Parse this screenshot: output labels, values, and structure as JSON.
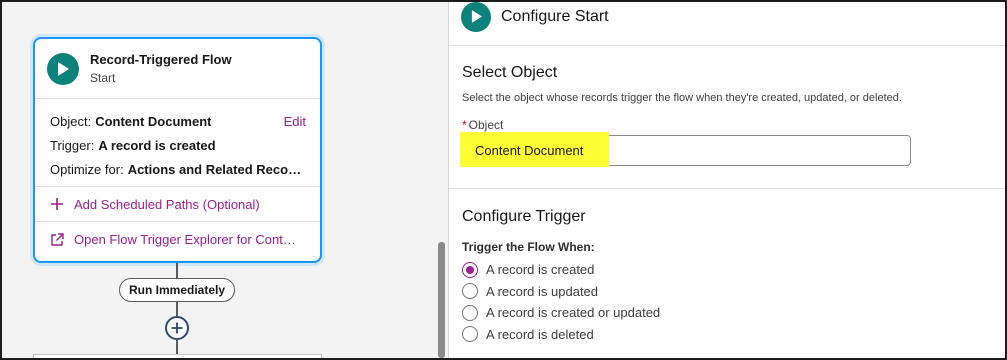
{
  "flow_node": {
    "title": "Record-Triggered Flow",
    "subtitle": "Start",
    "object_label": "Object:",
    "object_value": "Content Document",
    "edit_label": "Edit",
    "trigger_label": "Trigger:",
    "trigger_value": "A record is created",
    "optimize_label": "Optimize for:",
    "optimize_value": "Actions and Related Records",
    "add_paths_label": "Add Scheduled Paths (Optional)",
    "explorer_label": "Open Flow Trigger Explorer for Content Document"
  },
  "path": {
    "run_immediately_label": "Run Immediately"
  },
  "panel": {
    "title": "Configure Start",
    "select_object": {
      "heading": "Select Object",
      "help": "Select the object whose records trigger the flow when they're created, updated, or deleted.",
      "required_mark": "*",
      "field_label": "Object",
      "field_value": "Content Document"
    },
    "configure_trigger": {
      "heading": "Configure Trigger",
      "sub_label": "Trigger the Flow When:",
      "options": [
        {
          "label": "A record is created",
          "selected": true
        },
        {
          "label": "A record is updated",
          "selected": false
        },
        {
          "label": "A record is created or updated",
          "selected": false
        },
        {
          "label": "A record is deleted",
          "selected": false
        }
      ]
    }
  },
  "colors": {
    "accent_teal": "#0b827c",
    "link_purple": "#9b1f8f",
    "selection_blue": "#1b96ff",
    "highlight_yellow": "#ffff33"
  },
  "icons": [
    "play-icon",
    "plus-icon",
    "external-link-icon",
    "add-element-icon"
  ]
}
